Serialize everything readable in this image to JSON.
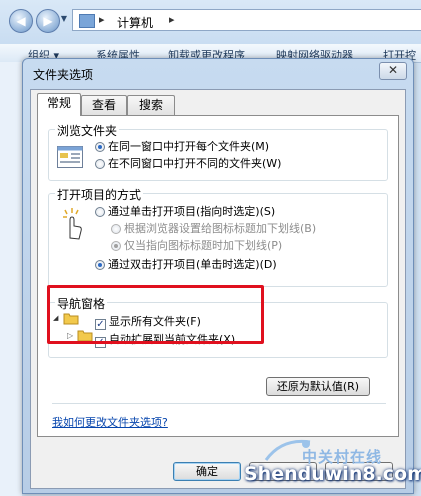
{
  "explorer": {
    "breadcrumb": "计算机",
    "toolbar": [
      "组织 ▾",
      "系统属性",
      "卸载或更改程序",
      "映射网络驱动器",
      "打开控"
    ]
  },
  "dialog": {
    "title": "文件夹选项",
    "close_glyph": "✕",
    "tabs": [
      "常规",
      "查看",
      "搜索"
    ],
    "browse": {
      "title": "浏览文件夹",
      "options": [
        "在同一窗口中打开每个文件夹(M)",
        "在不同窗口中打开不同的文件夹(W)"
      ]
    },
    "click": {
      "title": "打开项目的方式",
      "single": "通过单击打开项目(指向时选定)(S)",
      "sub1": "根据浏览器设置给图标标题加下划线(B)",
      "sub2": "仅当指向图标标题时加下划线(P)",
      "double": "通过双击打开项目(单击时选定)(D)"
    },
    "nav": {
      "title": "导航窗格",
      "show_all": "显示所有文件夹(F)",
      "auto_expand": "自动扩展到当前文件夹(X)"
    },
    "restore_button": "还原为默认值(R)",
    "help_link": "我如何更改文件夹选项?",
    "ok_button": "确定"
  },
  "watermark": {
    "small": "中关村在线",
    "big": "Shenduwin8.com"
  },
  "colors": {
    "highlight_box": "#e0101e",
    "link": "#0645ad"
  }
}
